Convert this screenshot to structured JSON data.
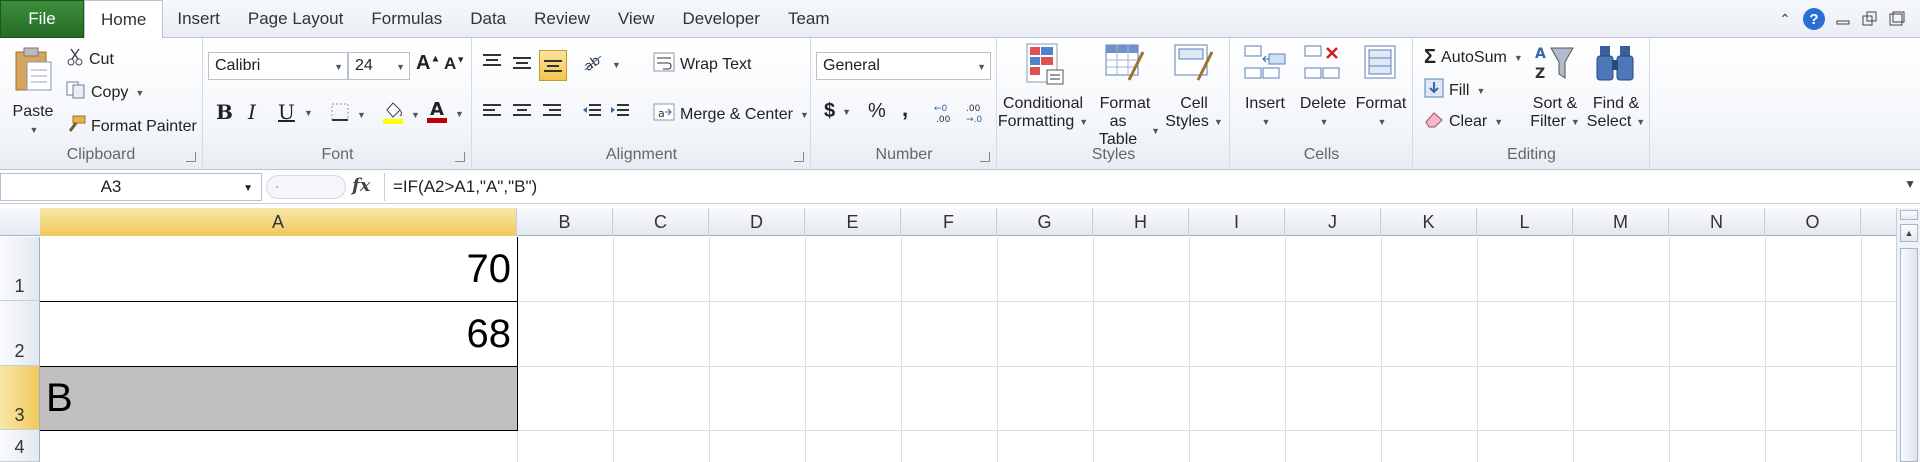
{
  "tabs": [
    "File",
    "Home",
    "Insert",
    "Page Layout",
    "Formulas",
    "Data",
    "Review",
    "View",
    "Developer",
    "Team"
  ],
  "active_tab": "Home",
  "clipboard": {
    "paste": "Paste",
    "cut": "Cut",
    "copy": "Copy",
    "format_painter": "Format Painter",
    "label": "Clipboard"
  },
  "font": {
    "name": "Calibri",
    "size": "24",
    "bold": "B",
    "italic": "I",
    "underline": "U",
    "label": "Font"
  },
  "alignment": {
    "wrap_text": "Wrap Text",
    "merge_center": "Merge & Center",
    "label": "Alignment"
  },
  "number": {
    "format": "General",
    "currency": "$",
    "percent": "%",
    "comma": ",",
    "label": "Number"
  },
  "styles": {
    "conditional_1": "Conditional",
    "conditional_2": "Formatting",
    "format_table_1": "Format",
    "format_table_2": "as Table",
    "cell_styles_1": "Cell",
    "cell_styles_2": "Styles",
    "label": "Styles"
  },
  "cells_group": {
    "insert": "Insert",
    "delete": "Delete",
    "format": "Format",
    "label": "Cells"
  },
  "editing": {
    "autosum": "AutoSum",
    "fill": "Fill",
    "clear": "Clear",
    "sort_1": "Sort &",
    "sort_2": "Filter",
    "find_1": "Find &",
    "find_2": "Select",
    "label": "Editing"
  },
  "formula_bar": {
    "name_box": "A3",
    "fx": "fx",
    "formula": "=IF(A2>A1,\"A\",\"B\")"
  },
  "columns": [
    "A",
    "B",
    "C",
    "D",
    "E",
    "F",
    "G",
    "H",
    "I",
    "J",
    "K",
    "L",
    "M",
    "N",
    "O"
  ],
  "rows": [
    "1",
    "2",
    "3",
    "4"
  ],
  "selected_cell": "A3",
  "cells": {
    "A1": "70",
    "A2": "68",
    "A3": "B"
  },
  "colors": {
    "file_tab": "#2f7d2f",
    "selection_header": "#f1c95b",
    "selected_fill": "#c0c0c0",
    "help": "#2a6fd6"
  }
}
